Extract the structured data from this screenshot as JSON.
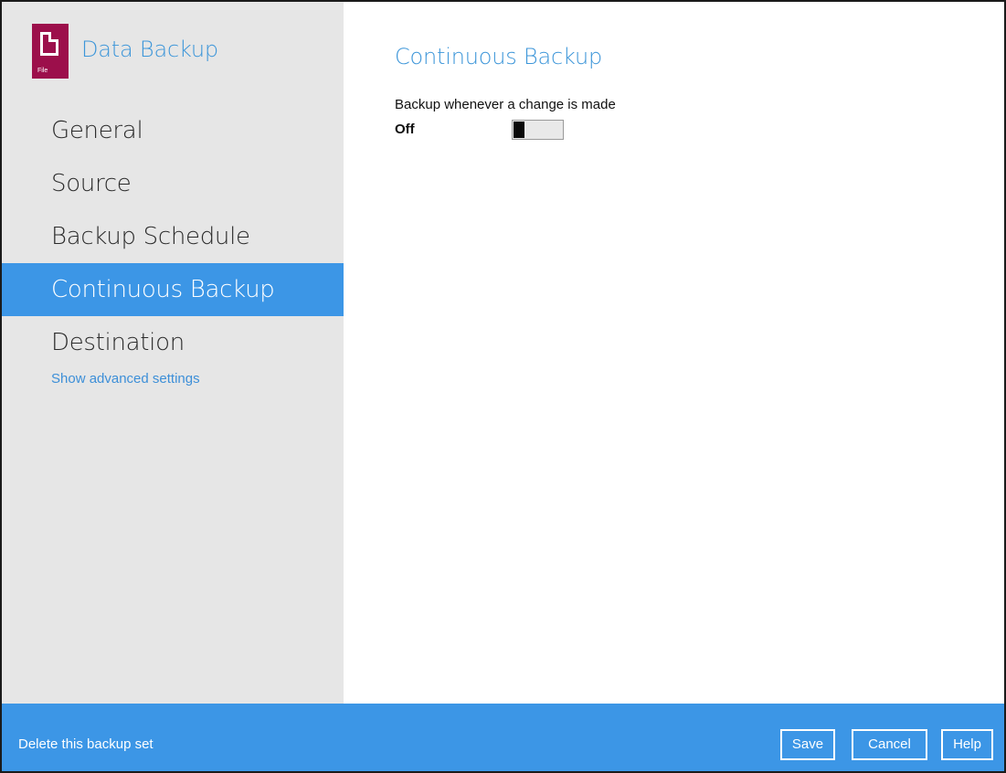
{
  "app": {
    "icon_name": "file-document-icon",
    "icon_tag": "File",
    "title": "Data Backup"
  },
  "sidebar": {
    "items": [
      {
        "label": "General",
        "active": false
      },
      {
        "label": "Source",
        "active": false
      },
      {
        "label": "Backup Schedule",
        "active": false
      },
      {
        "label": "Continuous Backup",
        "active": true
      },
      {
        "label": "Destination",
        "active": false
      }
    ],
    "advanced_link": "Show advanced settings"
  },
  "main": {
    "section_title": "Continuous Backup",
    "setting_label": "Backup whenever a change is made",
    "toggle": {
      "state_label": "Off",
      "on": false
    }
  },
  "footer": {
    "delete_link": "Delete this backup set",
    "save_label": "Save",
    "cancel_label": "Cancel",
    "help_label": "Help"
  },
  "colors": {
    "accent": "#3c96e6",
    "title_blue": "#3d96d9",
    "brand": "#9c0f4b",
    "sidebar_bg": "#e6e6e6"
  }
}
